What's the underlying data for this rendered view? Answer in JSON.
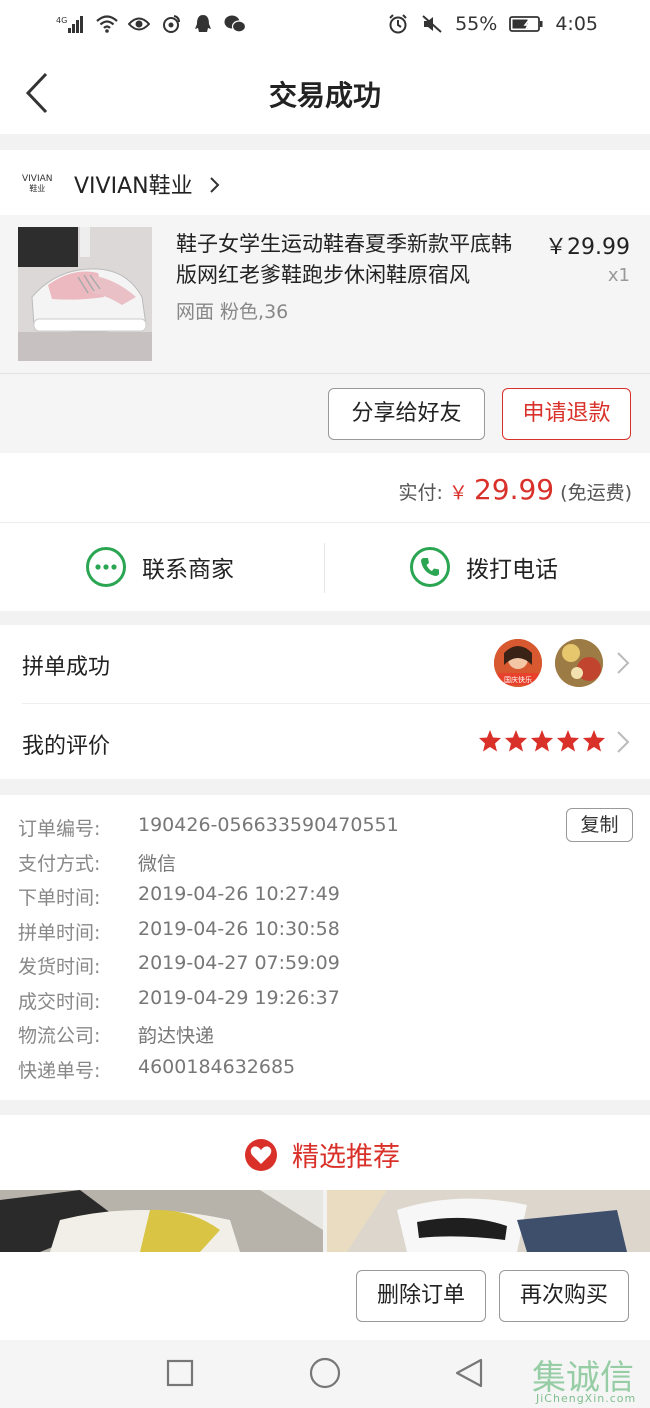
{
  "status_bar": {
    "network": "4G",
    "battery": "55%",
    "time": "4:05"
  },
  "header": {
    "title": "交易成功"
  },
  "shop": {
    "logo_line1": "VIVIAN",
    "logo_line2": "鞋业",
    "name": "VIVIAN鞋业"
  },
  "product": {
    "title": "鞋子女学生运动鞋春夏季新款平底韩版网红老爹鞋跑步休闲鞋原宿风",
    "spec": "网面 粉色,36",
    "price": "￥29.99",
    "quantity": "x1",
    "share_label": "分享给好友",
    "refund_label": "申请退款"
  },
  "payment": {
    "label": "实付:",
    "currency": "￥",
    "amount": "29.99",
    "note": "(免运费)"
  },
  "contact": {
    "merchant_label": "联系商家",
    "phone_label": "拨打电话"
  },
  "group": {
    "label": "拼单成功",
    "avatar1_text": "国庆快乐"
  },
  "review": {
    "label": "我的评价",
    "stars": 5
  },
  "order_info": {
    "copy_label": "复制",
    "rows": [
      {
        "key": "订单编号:",
        "value": "190426-056633590470551"
      },
      {
        "key": "支付方式:",
        "value": "微信"
      },
      {
        "key": "下单时间:",
        "value": "2019-04-26 10:27:49"
      },
      {
        "key": "拼单时间:",
        "value": "2019-04-26 10:30:58"
      },
      {
        "key": "发货时间:",
        "value": "2019-04-27 07:59:09"
      },
      {
        "key": "成交时间:",
        "value": "2019-04-29 19:26:37"
      },
      {
        "key": "物流公司:",
        "value": "韵达快递"
      },
      {
        "key": "快递单号:",
        "value": "4600184632685"
      }
    ]
  },
  "recommend": {
    "title": "精选推荐"
  },
  "bottom_bar": {
    "delete_label": "删除订单",
    "rebuy_label": "再次购买"
  },
  "watermark": {
    "text": "集诚信",
    "sub": "JiChengXin.com"
  },
  "colors": {
    "accent_red": "#d9312a",
    "contact_green": "#2aa552"
  }
}
